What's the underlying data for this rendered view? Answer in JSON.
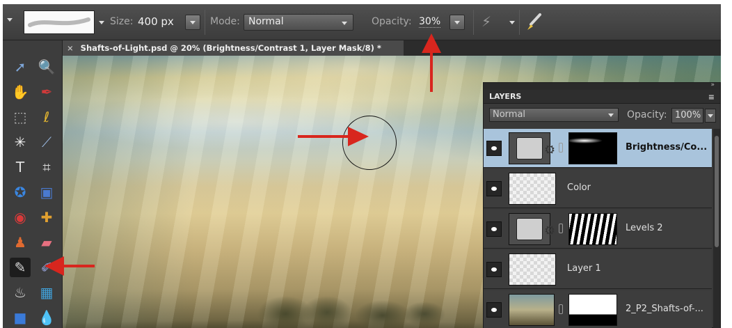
{
  "options_bar": {
    "size_label": "Size:",
    "size_value": "400 px",
    "mode_label": "Mode:",
    "mode_value": "Normal",
    "opacity_label": "Opacity:",
    "opacity_value": "30%"
  },
  "document_tab": {
    "close_glyph": "×",
    "title": "Shafts-of-Light.psd @ 20% (Brightness/Contrast 1, Layer Mask/8) *"
  },
  "toolbox": {
    "tools": [
      {
        "name": "move-tool-icon",
        "glyph": "➚"
      },
      {
        "name": "zoom-tool-icon",
        "glyph": "🔍"
      },
      {
        "name": "hand-tool-icon",
        "glyph": "✋"
      },
      {
        "name": "eyedropper-tool-icon",
        "glyph": "✒"
      },
      {
        "name": "marquee-tool-icon",
        "glyph": "⬚"
      },
      {
        "name": "lasso-tool-icon",
        "glyph": "ℓ"
      },
      {
        "name": "magic-wand-tool-icon",
        "glyph": "✳"
      },
      {
        "name": "quick-selection-tool-icon",
        "glyph": "⟋"
      },
      {
        "name": "type-tool-icon",
        "glyph": "T"
      },
      {
        "name": "crop-tool-icon",
        "glyph": "⌗"
      },
      {
        "name": "cookie-cutter-tool-icon",
        "glyph": "✪"
      },
      {
        "name": "straighten-tool-icon",
        "glyph": "▣"
      },
      {
        "name": "red-eye-tool-icon",
        "glyph": "◉"
      },
      {
        "name": "healing-tool-icon",
        "glyph": "✚"
      },
      {
        "name": "clone-stamp-tool-icon",
        "glyph": "♟"
      },
      {
        "name": "eraser-tool-icon",
        "glyph": "▰"
      },
      {
        "name": "brush-tool-icon",
        "glyph": "✎"
      },
      {
        "name": "smart-brush-tool-icon",
        "glyph": "✐"
      },
      {
        "name": "paint-bucket-tool-icon",
        "glyph": "♨"
      },
      {
        "name": "gradient-tool-icon",
        "glyph": "▦"
      },
      {
        "name": "shape-tool-icon",
        "glyph": "■"
      },
      {
        "name": "blur-tool-icon",
        "glyph": "💧"
      }
    ],
    "active_tool": "brush-tool-icon"
  },
  "layers_panel": {
    "title": "LAYERS",
    "blend_mode": "Normal",
    "opacity_label": "Opacity:",
    "opacity_value": "100%",
    "layers": [
      {
        "name": "Brightness/Co...",
        "thumb": "adjustment",
        "mask": "black",
        "selected": true
      },
      {
        "name": "Color",
        "thumb": "transparent",
        "mask": "",
        "selected": false
      },
      {
        "name": "Levels 2",
        "thumb": "adjustment",
        "mask": "stripes",
        "selected": false
      },
      {
        "name": "Layer 1",
        "thumb": "transparent",
        "mask": "",
        "selected": false
      },
      {
        "name": "2_P2_Shafts-of-...",
        "thumb": "photo",
        "mask": "half",
        "selected": false
      }
    ]
  },
  "colors": {
    "annotation_arrow": "#d8261e",
    "selected_layer": "#a9c4dc"
  }
}
